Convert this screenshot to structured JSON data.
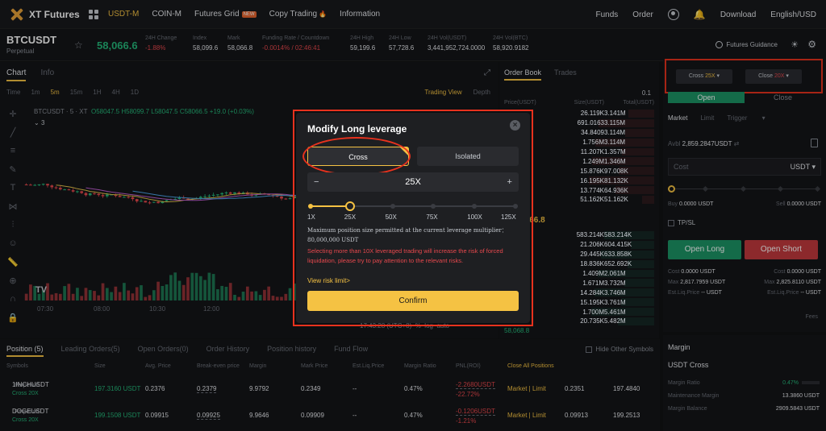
{
  "nav": {
    "logo": "XT Futures",
    "items": [
      "USDT-M",
      "COIN-M",
      "Futures Grid",
      "Copy Trading",
      "Information"
    ],
    "new_badge": "NEW",
    "right": [
      "Funds",
      "Order",
      "Download",
      "English/USD"
    ]
  },
  "ticker": {
    "symbol": "BTCUSDT",
    "sub": "Perpetual",
    "last_price": "58,066.6",
    "stats": [
      {
        "label": "24H Change",
        "value": "-1.88%"
      },
      {
        "label": "Index",
        "value": "58,099.6"
      },
      {
        "label": "Mark",
        "value": "58,066.8"
      },
      {
        "label": "Funding Rate / Countdown",
        "value": "-0.0014% / 02:46:41"
      },
      {
        "label": "24H High",
        "value": "59,199.6"
      },
      {
        "label": "24H Low",
        "value": "57,728.6"
      },
      {
        "label": "24H Vol(USDT)",
        "value": "3,441,952,724.0000"
      },
      {
        "label": "24H Vol(BTC)",
        "value": "58,920.9182"
      }
    ],
    "guidance": "Futures Guidance"
  },
  "chart": {
    "tabs": [
      "Chart",
      "Info"
    ],
    "intervals": [
      "Time",
      "1m",
      "5m",
      "15m",
      "1H",
      "4H",
      "1D"
    ],
    "active_interval": "5m",
    "views": [
      "Trading View",
      "Depth"
    ],
    "ohlc_symbol": "BTCUSDT · 5 · XT",
    "ohlc_values": "O58047.5 H58099.7 L58047.5 C58066.5 +19.0 (+0.03%)",
    "indicator_count": "3",
    "time_labels": [
      "07:30",
      "08:00",
      "10:30",
      "12:00"
    ],
    "tv_logo": "TV",
    "crosshair_readout": "17:43:28 (UTC+8)",
    "crosshair_scale": "%",
    "crosshair_mode": "log",
    "crosshair_auto": "auto",
    "y_axis_label": "6"
  },
  "orderbook": {
    "tabs": [
      "Order Book",
      "Trades"
    ],
    "step": "0.1",
    "headers": [
      "Price(USDT)",
      "Size(USDT)",
      "Total(USDT)"
    ],
    "sells": [
      {
        "size": "26.119K",
        "total": "3.141M"
      },
      {
        "size": "691.0163",
        "total": "3.115M"
      },
      {
        "size": "34.8409",
        "total": "3.114M"
      },
      {
        "size": "1.756M",
        "total": "3.114M"
      },
      {
        "size": "11.207K",
        "total": "1.357M"
      },
      {
        "size": "1.249M",
        "total": "1.346M"
      },
      {
        "size": "15.876K",
        "total": "97.008K"
      },
      {
        "size": "16.195K",
        "total": "81.132K"
      },
      {
        "size": "13.774K",
        "total": "64.936K"
      },
      {
        "size": "51.162K",
        "total": "51.162K"
      }
    ],
    "mid_price": "58,066.8",
    "buys": [
      {
        "size": "583.214K",
        "total": "583.214K"
      },
      {
        "size": "21.206K",
        "total": "604.415K"
      },
      {
        "size": "29.445K",
        "total": "633.858K"
      },
      {
        "size": "18.836K",
        "total": "652.692K"
      },
      {
        "size": "1.409M",
        "total": "2.061M"
      },
      {
        "size": "1.671M",
        "total": "3.732M"
      },
      {
        "size": "14.284K",
        "total": "3.746M"
      },
      {
        "size": "15.195K",
        "total": "3.761M"
      },
      {
        "size": "1.700M",
        "total": "5.461M"
      },
      {
        "size": "20.735K",
        "total": "5.482M"
      }
    ],
    "last_buy_price": "58,068.8"
  },
  "order_panel": {
    "cross_label": "Cross",
    "cross_value": "25X",
    "close_label": "Close",
    "close_value": "20X",
    "open_tab": "Open",
    "close_tab": "Close",
    "order_types": [
      "Market",
      "Limit",
      "Trigger"
    ],
    "avbl_label": "Avbl",
    "avbl_value": "2,859.2847USDT",
    "cost_label": "Cost",
    "cost_unit": "USDT",
    "buy_label": "Buy",
    "buy_value": "0.0000 USDT",
    "sell_label": "Sell",
    "sell_value": "0.0000 USDT",
    "tpsl": "TP/SL",
    "open_long": "Open Long",
    "open_short": "Open Short",
    "long_lines": [
      {
        "label": "Cost",
        "value": "0.0000 USDT"
      },
      {
        "label": "Max",
        "value": "2,817.7959 USDT"
      },
      {
        "label": "Est.Liq.Price",
        "value": "-- USDT"
      }
    ],
    "short_lines": [
      {
        "label": "Cost",
        "value": "0.0000 USDT"
      },
      {
        "label": "Max",
        "value": "2,825.8110 USDT"
      },
      {
        "label": "Est.Liq.Price",
        "value": "-- USDT"
      }
    ],
    "fees": "Fees"
  },
  "positions": {
    "tabs": [
      "Position (5)",
      "Leading Orders(5)",
      "Open Orders(0)",
      "Order History",
      "Position history",
      "Fund Flow"
    ],
    "hide_other": "Hide Other Symbols",
    "headers": [
      "Symbols",
      "Size",
      "Avg. Price",
      "Break-even price",
      "Margin",
      "Mark Price",
      "Est.Liq.Price",
      "Margin Ratio",
      "PNL(ROI)"
    ],
    "close_all": "Close All Positions",
    "rows": [
      {
        "symbol": "1INCHUSDT",
        "type": "Perpetual",
        "lev": "Cross 20X",
        "size": "197.3160 USDT",
        "avg": "0.2376",
        "be": "0.2379",
        "margin": "9.9792",
        "mark": "0.2349",
        "liq": "--",
        "ratio": "0.47%",
        "pnl": "-2.2680USDT",
        "roi": "-22.72%",
        "action": "Market | Limit",
        "p1": "0.2351",
        "p2": "197.4840"
      },
      {
        "symbol": "DOGEUSDT",
        "type": "Perpetual",
        "lev": "Cross 20X",
        "size": "199.1508 USDT",
        "avg": "0.09915",
        "be": "0.09925",
        "margin": "9.9646",
        "mark": "0.09909",
        "liq": "--",
        "ratio": "0.47%",
        "pnl": "-0.1206USDT",
        "roi": "-1.21%",
        "action": "Market | Limit",
        "p1": "0.09913",
        "p2": "199.2513"
      }
    ]
  },
  "margin": {
    "title": "Margin",
    "mode": "USDT Cross",
    "rows": [
      {
        "label": "Margin Ratio",
        "value": "0.47%"
      },
      {
        "label": "Maintenance Margin",
        "value": "13.3860 USDT"
      },
      {
        "label": "Margin Balance",
        "value": "2909.5843 USDT"
      }
    ]
  },
  "modal": {
    "title": "Modify Long leverage",
    "tab_cross": "Cross",
    "tab_isolated": "Isolated",
    "minus": "−",
    "plus": "+",
    "value": "25X",
    "marks": [
      "1X",
      "25X",
      "50X",
      "75X",
      "100X",
      "125X"
    ],
    "current_leverage": 25,
    "max_leverage": 125,
    "max_text": "Maximum position size permitted at the current leverage multiplier： 80,000,000 USDT",
    "warning": "Selecting more than 10X leveraged trading will increase the risk of forced liquidation, please try to pay attention to the relevant risks.",
    "risk_link": "View risk limit>",
    "confirm": "Confirm"
  }
}
